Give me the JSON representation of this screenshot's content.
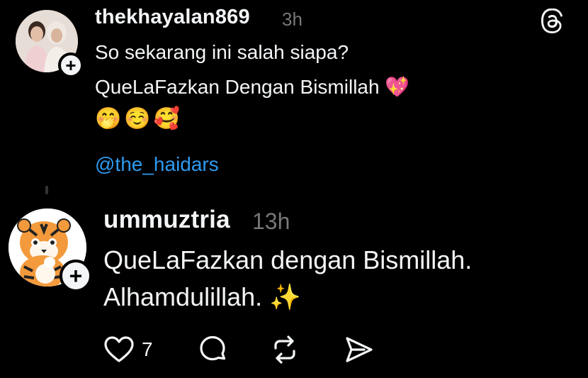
{
  "post": {
    "username": "thekhayalan869",
    "time": "3h",
    "lines": [
      "So sekarang ini salah siapa?",
      "QueLaFazkan Dengan Bismillah 💖",
      "🤭☺️🥰"
    ],
    "mention": "@the_haidars",
    "follow_symbol": "+"
  },
  "reply": {
    "username": "ummuztria",
    "time": "13h",
    "lines": [
      "QueLaFazkan dengan Bismillah.",
      "Alhamdulillah. ✨"
    ],
    "follow_symbol": "+",
    "actions": {
      "like_count": "7"
    }
  },
  "icons": {
    "app": "threads-logo-icon",
    "like": "heart-icon",
    "comment": "comment-bubble-icon",
    "repost": "repost-icon",
    "share": "share-send-icon"
  },
  "colors": {
    "background": "#000000",
    "text": "#f3f5f7",
    "muted": "#777777",
    "mention": "#2f9bf0"
  }
}
